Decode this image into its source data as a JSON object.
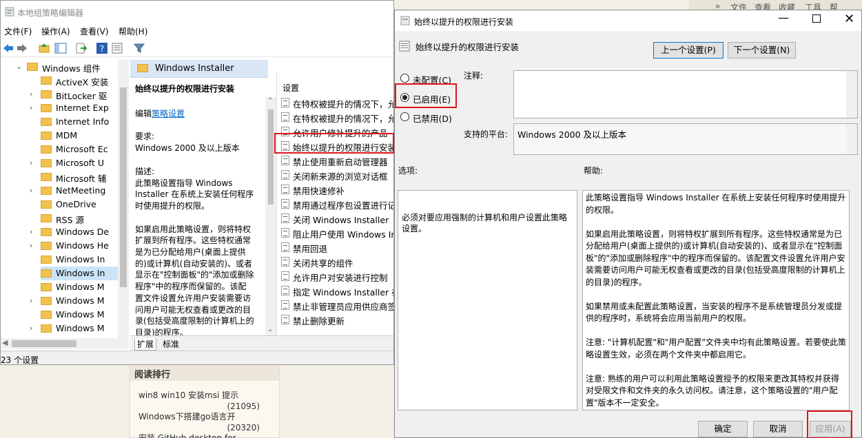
{
  "web": {
    "top_links": [
      "»",
      "文件",
      "查看",
      "收藏",
      "工具",
      "帮"
    ],
    "ranking_title": "阅读排行",
    "ranking": [
      {
        "title": "win8 win10 安装msi 提示",
        "count": "(21095)"
      },
      {
        "title": "Windows下搭建go语言开",
        "count": "(20320)"
      },
      {
        "title": "安装 GitHub desktop for",
        "count": ""
      }
    ]
  },
  "gpedit": {
    "title": "本地组策略编辑器",
    "menu": [
      "文件(F)",
      "操作(A)",
      "查看(V)",
      "帮助(H)"
    ],
    "tree": [
      {
        "label": "Windows 组件",
        "arrow": "v",
        "indent": 0
      },
      {
        "label": "ActiveX 安装",
        "arrow": "",
        "indent": 1
      },
      {
        "label": "BitLocker 驱",
        "arrow": ">",
        "indent": 1
      },
      {
        "label": "Internet Exp",
        "arrow": ">",
        "indent": 1
      },
      {
        "label": "Internet Info",
        "arrow": "",
        "indent": 1
      },
      {
        "label": "MDM",
        "arrow": "",
        "indent": 1
      },
      {
        "label": "Microsoft Ec",
        "arrow": "",
        "indent": 1
      },
      {
        "label": "Microsoft U",
        "arrow": ">",
        "indent": 1
      },
      {
        "label": "Microsoft 辅",
        "arrow": "",
        "indent": 1
      },
      {
        "label": "NetMeeting",
        "arrow": ">",
        "indent": 1
      },
      {
        "label": "OneDrive",
        "arrow": "",
        "indent": 1
      },
      {
        "label": "RSS 源",
        "arrow": "",
        "indent": 1
      },
      {
        "label": "Windows De",
        "arrow": ">",
        "indent": 1
      },
      {
        "label": "Windows He",
        "arrow": ">",
        "indent": 1
      },
      {
        "label": "Windows In",
        "arrow": "",
        "indent": 1
      },
      {
        "label": "Windows In",
        "arrow": "",
        "indent": 1,
        "selected": true
      },
      {
        "label": "Windows M",
        "arrow": "",
        "indent": 1
      },
      {
        "label": "Windows M",
        "arrow": ">",
        "indent": 1
      },
      {
        "label": "Windows M",
        "arrow": "",
        "indent": 1
      },
      {
        "label": "Windows M",
        "arrow": ">",
        "indent": 1
      }
    ],
    "mid_header": "Windows Installer",
    "mid": {
      "heading": "始终以提升的权限进行安装",
      "edit_prefix": "编辑",
      "edit_link": "策略设置",
      "req_label": "要求:",
      "req_value": "Windows 2000 及以上版本",
      "desc_label": "描述:",
      "desc1": "此策略设置指导 Windows Installer 在系统上安装任何程序时使用提升的权限。",
      "desc2": "如果启用此策略设置，则将特权扩展到所有程序。这些特权通常是为已分配给用户(桌面上提供的)或计算机(自动安装的)、或者显示在\"控制面板\"的\"添加或删除程序\"中的程序而保留的。该配置文件设置允许用户安装需要访问用户可能无权查看或更改的目录(包括受高度限制的计算机上的目录)的程序。"
    },
    "list_header": "设置",
    "list": [
      "在特权被提升的情况下，允许",
      "在特权被提升的情况下，允许",
      "允许用户修补提升的产品",
      "始终以提升的权限进行安装",
      "禁止使用重新启动管理器",
      "关闭新来源的浏览对话框",
      "禁用快速修补",
      "禁用通过程序包设置进行记录",
      "关闭 Windows Installer",
      "阻止用户使用 Windows Installer",
      "禁用回退",
      "关闭共享的组件",
      "允许用户对安装进行控制",
      "指定 Windows Installer 在",
      "禁止非管理员应用供应商签名",
      "禁止删除更新"
    ],
    "tabs": [
      "扩展",
      "标准"
    ],
    "status": "23 个设置"
  },
  "dialog": {
    "title": "始终以提升的权限进行安装",
    "subtitle": "始终以提升的权限进行安装",
    "prev": "上一个设置(P)",
    "next": "下一个设置(N)",
    "radios": [
      {
        "label": "未配置(C)",
        "checked": false
      },
      {
        "label": "已启用(E)",
        "checked": true
      },
      {
        "label": "已禁用(D)",
        "checked": false
      }
    ],
    "comment_label": "注释:",
    "platform_label": "支持的平台:",
    "platform_value": "Windows 2000 及以上版本",
    "options_label": "选项:",
    "help_label": "帮助:",
    "options_text": "必须对要应用强制的计算机和用户设置此策略设置。",
    "help": [
      "此策略设置指导 Windows Installer 在系统上安装任何程序时使用提升的权限。",
      "如果启用此策略设置，则将特权扩展到所有程序。这些特权通常是为已分配给用户(桌面上提供的)或计算机(自动安装的)、或者显示在\"控制面板\"的\"添加或删除程序\"中的程序而保留的。该配置文件设置允许用户安装需要访问用户可能无权查看或更改的目录(包括受高度限制的计算机上的目录)的程序。",
      "如果禁用或未配置此策略设置，当安装的程序不是系统管理员分发或提供的程序时，系统将会应用当前用户的权限。",
      "注意: \"计算机配置\"和\"用户配置\"文件夹中均有此策略设置。若要使此策略设置生效，必须在两个文件夹中都启用它。",
      "注意: 熟练的用户可以利用此策略设置授予的权限来更改其特权并获得对受限文件和文件夹的永久访问权。请注意，这个策略设置的\"用户配置\"版本不一定安全。"
    ],
    "ok": "确定",
    "cancel": "取消",
    "apply": "应用(A)"
  },
  "colors": {
    "highlight_red": "#e0141e",
    "accent_blue": "#0078d7",
    "selection": "#cce4f7"
  }
}
